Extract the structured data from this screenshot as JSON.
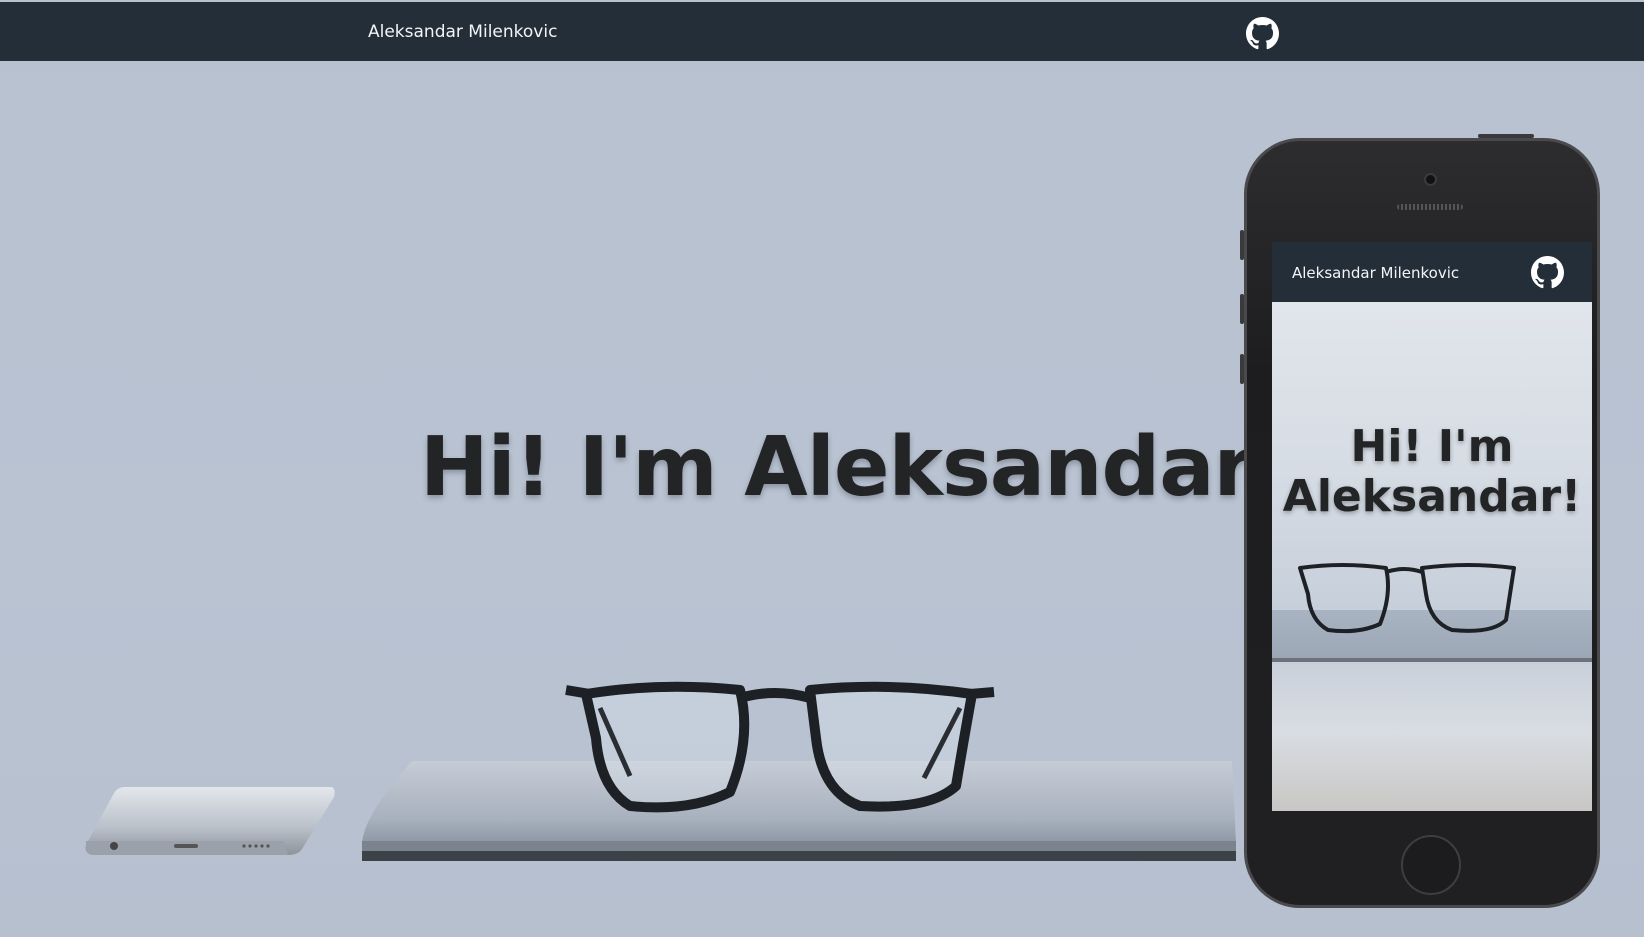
{
  "navbar": {
    "brand": "Aleksandar Milenkovic",
    "github_icon": "github-icon"
  },
  "hero": {
    "title": "Hi! I'm Aleksandar!"
  },
  "mobile_preview": {
    "brand": "Aleksandar Milenkovic",
    "github_icon": "github-icon",
    "title_line1": "Hi! I'm",
    "title_line2": "Aleksandar!"
  },
  "colors": {
    "navbar_bg": "#242e39",
    "page_bg": "#b8c2d1",
    "title_text": "#222426",
    "nav_text": "#f2f4f6"
  }
}
